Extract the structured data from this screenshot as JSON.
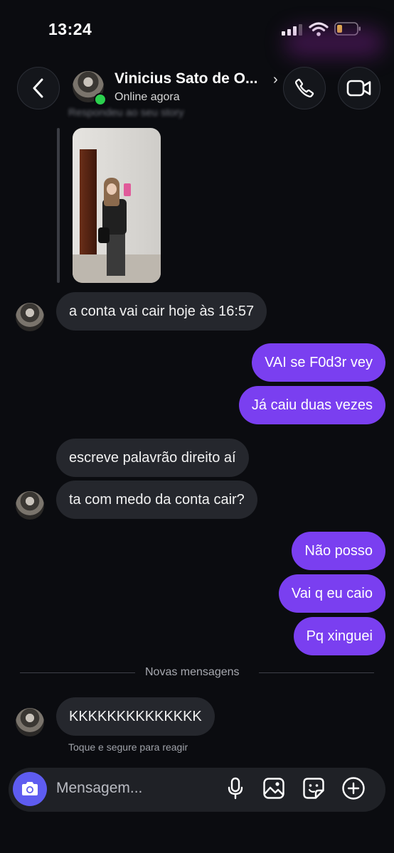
{
  "status_bar": {
    "time": "13:24"
  },
  "header": {
    "contact_name": "Vinicius Sato de O...",
    "status": "Online agora",
    "chevron": "›"
  },
  "story": {
    "reply_label": "Respondeu ao seu story"
  },
  "messages": [
    {
      "side": "in",
      "text": "a conta vai cair hoje às 16:57"
    },
    {
      "side": "out",
      "text": "VAI se F0d3r vey"
    },
    {
      "side": "out",
      "text": "Já caiu duas vezes"
    },
    {
      "side": "in",
      "text": "escreve palavrão direito aí"
    },
    {
      "side": "in",
      "text": "ta com medo da conta cair?"
    },
    {
      "side": "out",
      "text": "Não posso"
    },
    {
      "side": "out",
      "text": "Vai q eu caio"
    },
    {
      "side": "out",
      "text": "Pq xinguei"
    },
    {
      "side": "in",
      "text": "KKKKKKKKKKKKKK"
    }
  ],
  "divider": {
    "label": "Novas mensagens"
  },
  "hint": "Toque e segure para reagir",
  "composer": {
    "placeholder": "Mensagem..."
  },
  "icons": [
    "back-icon",
    "phone-icon",
    "video-icon",
    "camera-icon",
    "microphone-icon",
    "gallery-icon",
    "sticker-icon",
    "add-icon"
  ],
  "colors": {
    "background": "#0b0c10",
    "outgoing_bubble": "#7a3ff0",
    "incoming_bubble": "#25272d",
    "camera_button": "#5e5cf0",
    "online": "#2bd04e"
  }
}
